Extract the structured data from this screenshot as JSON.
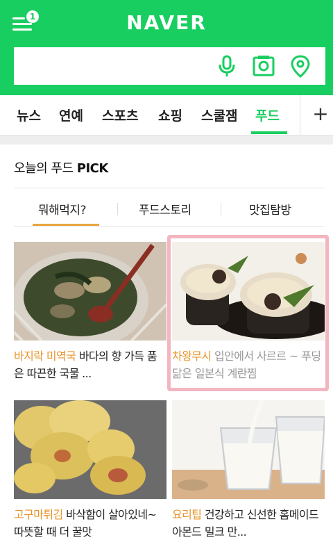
{
  "header": {
    "logo": "NAVER",
    "menu_badge": "1",
    "search_placeholder": ""
  },
  "tabs": [
    {
      "label": "뉴스"
    },
    {
      "label": "연예"
    },
    {
      "label": "스포츠"
    },
    {
      "label": "쇼핑"
    },
    {
      "label": "스쿨잼"
    },
    {
      "label": "푸드",
      "active": true
    }
  ],
  "tabs_add": "+",
  "card": {
    "title_prefix": "오늘의 푸드 ",
    "title_suffix": "PICK",
    "subtabs": [
      {
        "label": "뭐해먹지?",
        "active": true
      },
      {
        "label": "푸드스토리"
      },
      {
        "label": "맛집탐방"
      }
    ],
    "items": [
      {
        "keyword": "바지락 미역국",
        "text": " 바다의 향 가득 품은 따끈한 국물 ..."
      },
      {
        "keyword": "차왕무시",
        "text": " 입안에서 사르르 ~ 푸딩 닮은 일본식 계란찜"
      },
      {
        "keyword": "고구마튀김",
        "text": " 바삭함이 살아있네~ 따뜻할 때 더 꿀맛"
      },
      {
        "keyword": "요리팁",
        "text": " 건강하고 신선한 홈메이드 아몬드 밀크 만..."
      }
    ]
  },
  "colors": {
    "brand": "#19ce60",
    "accent": "#e8942a"
  },
  "icons": [
    "menu-icon",
    "mic-icon",
    "camera-search-icon",
    "location-icon",
    "plus-icon"
  ]
}
